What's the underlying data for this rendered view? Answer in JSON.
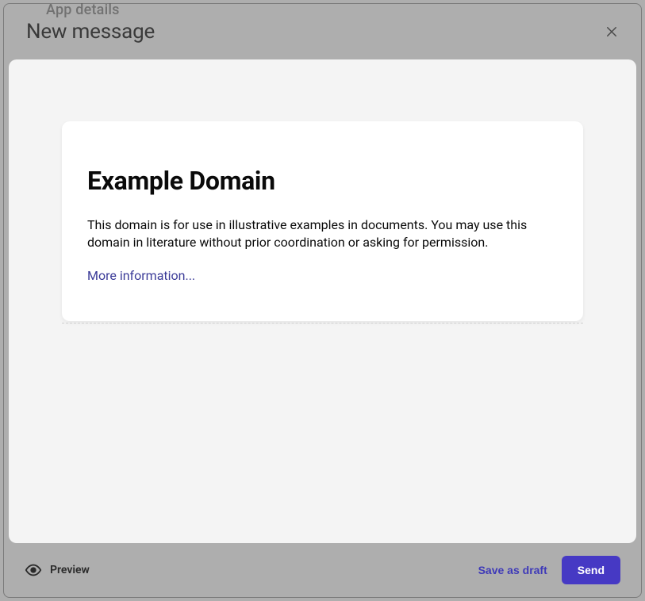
{
  "behind": {
    "text": "App details"
  },
  "header": {
    "title": "New message"
  },
  "card": {
    "heading": "Example Domain",
    "body": "This domain is for use in illustrative examples in documents. You may use this domain in literature without prior coordination or asking for permission.",
    "link_label": "More information..."
  },
  "footer": {
    "preview_label": "Preview",
    "save_draft_label": "Save as draft",
    "send_label": "Send"
  }
}
